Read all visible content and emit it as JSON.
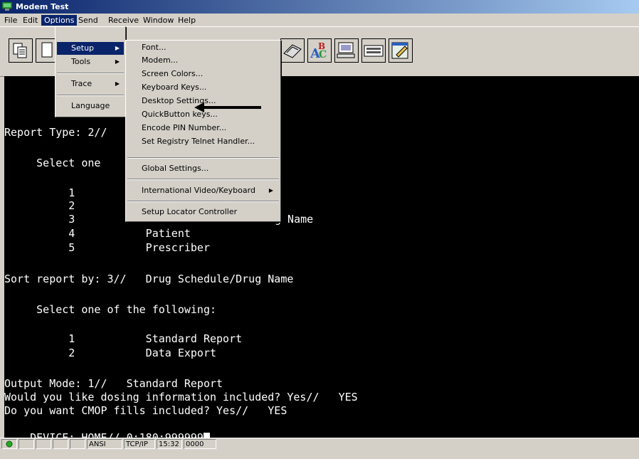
{
  "window": {
    "title": "Modem Test"
  },
  "menubar": {
    "items": [
      "File",
      "Edit",
      "Options",
      "Send",
      "Receive",
      "Window",
      "Help"
    ]
  },
  "options_menu": {
    "items": [
      "Setup",
      "Tools",
      "Trace",
      "Language"
    ]
  },
  "setup_submenu": {
    "items": [
      "Font...",
      "Modem...",
      "Screen Colors...",
      "Keyboard Keys...",
      "Desktop Settings...",
      "QuickButton keys...",
      "Encode PIN Number...",
      "Set Registry Telnet Handler...",
      "Global Settings...",
      "International Video/Keyboard",
      "Setup Locator Controller"
    ]
  },
  "terminal": {
    "lines": [
      "Report Type: 2//",
      "     Select one",
      "          1",
      "          2",
      "          3",
      "          4           Patient",
      "          5           Prescriber",
      "Sort report by: 3//   Drug Schedule/Drug Name",
      "     Select one of the following:",
      "          1           Standard Report",
      "          2           Data Export",
      "Output Mode: 1//   Standard Report",
      "Would you like dosing information included? Yes//   YES",
      "Do you want CMOP fills included? Yes//   YES",
      "DEVICE: HOME// 0;180;999999"
    ],
    "partial_line": "g Name"
  },
  "statusbar": {
    "fields": [
      "ANSI",
      "TCP/IP",
      "15:32",
      "0000"
    ]
  },
  "colors": {
    "terminal_bg": "#000000",
    "terminal_fg": "#ffffff",
    "highlight": "#0a246a",
    "status_led": "#22aa22"
  }
}
